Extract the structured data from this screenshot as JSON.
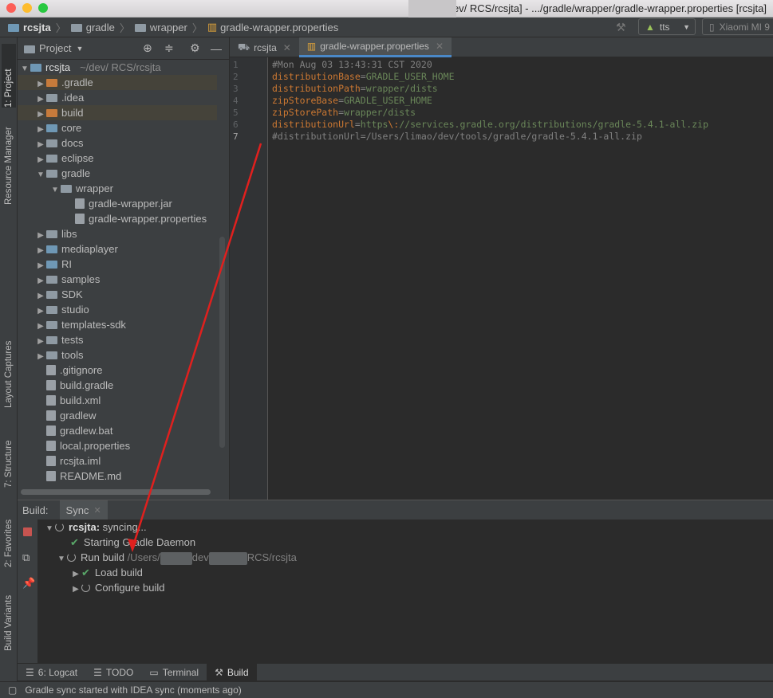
{
  "window": {
    "title": "rcsjta [~/dev/  RCS/rcsjta] - .../gradle/wrapper/gradle-wrapper.properties [rcsjta]"
  },
  "navbar": {
    "crumbs": [
      "rcsjta",
      "gradle",
      "wrapper",
      "gradle-wrapper.properties"
    ],
    "run_config": "tts",
    "device": "Xiaomi MI 9"
  },
  "side_tabs": {
    "project": "1: Project",
    "resource_manager": "Resource Manager",
    "layout_captures": "Layout Captures",
    "structure": "7: Structure",
    "favorites": "2: Favorites",
    "build_variants": "Build Variants"
  },
  "project_panel": {
    "title": "Project",
    "root": {
      "name": "rcsjta",
      "path": "~/dev/ RCS/rcsjta"
    },
    "items": [
      {
        "label": ".gradle",
        "type": "folder-orange",
        "expandable": true
      },
      {
        "label": ".idea",
        "type": "folder",
        "expandable": true
      },
      {
        "label": "build",
        "type": "folder-orange",
        "expandable": true
      },
      {
        "label": "core",
        "type": "folder-blue",
        "expandable": true
      },
      {
        "label": "docs",
        "type": "folder",
        "expandable": true
      },
      {
        "label": "eclipse",
        "type": "folder",
        "expandable": true
      },
      {
        "label": "gradle",
        "type": "folder",
        "expandable": true
      },
      {
        "label": "wrapper",
        "type": "folder",
        "expandable": true
      },
      {
        "label": "gradle-wrapper.jar",
        "type": "file"
      },
      {
        "label": "gradle-wrapper.properties",
        "type": "file"
      },
      {
        "label": "libs",
        "type": "folder",
        "expandable": true
      },
      {
        "label": "mediaplayer",
        "type": "folder-blue",
        "expandable": true
      },
      {
        "label": "RI",
        "type": "folder-blue",
        "expandable": true
      },
      {
        "label": "samples",
        "type": "folder",
        "expandable": true
      },
      {
        "label": "SDK",
        "type": "folder",
        "expandable": true
      },
      {
        "label": "studio",
        "type": "folder",
        "expandable": true
      },
      {
        "label": "templates-sdk",
        "type": "folder",
        "expandable": true
      },
      {
        "label": "tests",
        "type": "folder",
        "expandable": true
      },
      {
        "label": "tools",
        "type": "folder",
        "expandable": true
      },
      {
        "label": ".gitignore",
        "type": "file"
      },
      {
        "label": "build.gradle",
        "type": "file"
      },
      {
        "label": "build.xml",
        "type": "file"
      },
      {
        "label": "gradlew",
        "type": "file"
      },
      {
        "label": "gradlew.bat",
        "type": "file"
      },
      {
        "label": "local.properties",
        "type": "file"
      },
      {
        "label": "rcsjta.iml",
        "type": "file"
      },
      {
        "label": "README.md",
        "type": "file"
      }
    ]
  },
  "editor": {
    "tabs": [
      {
        "label": "rcsjta",
        "active": false
      },
      {
        "label": "gradle-wrapper.properties",
        "active": true
      }
    ],
    "line_numbers": [
      "1",
      "2",
      "3",
      "4",
      "5",
      "6",
      "7"
    ],
    "lines": [
      {
        "comment": "#Mon Aug 03 13:43:31 CST 2020"
      },
      {
        "key": "distributionBase",
        "eq": "=",
        "value": "GRADLE_USER_HOME"
      },
      {
        "key": "distributionPath",
        "eq": "=",
        "value": "wrapper/dists"
      },
      {
        "key": "zipStoreBase",
        "eq": "=",
        "value": "GRADLE_USER_HOME"
      },
      {
        "key": "zipStorePath",
        "eq": "=",
        "value": "wrapper/dists"
      },
      {
        "key": "distributionUrl",
        "eq": "=",
        "value_a": "https",
        "value_esc": "\\:",
        "value_b": "//services.gradle.org/distributions/gradle-5.4.1-all.zip"
      },
      {
        "comment": "#distributionUrl=/Users/limao/dev/tools/gradle/gradle-5.4.1-all.zip"
      }
    ]
  },
  "build": {
    "label": "Build:",
    "tab": "Sync",
    "tree": {
      "root_name": "rcsjta:",
      "root_status": "syncing...",
      "starting": "Starting Gradle Daemon",
      "run_build": "Run build",
      "run_path_a": "/Users/",
      "run_path_b": "dev",
      "run_path_c": "RCS/rcsjta",
      "load_build": "Load build",
      "configure_build": "Configure build"
    }
  },
  "bottom_tabs": {
    "logcat": "6: Logcat",
    "todo": "TODO",
    "terminal": "Terminal",
    "build": "Build"
  },
  "status": {
    "message": "Gradle sync started with IDEA sync (moments ago)"
  },
  "colors": {
    "accent": "#4a88c7",
    "success": "#59a869",
    "annotation": "#e0201e"
  }
}
